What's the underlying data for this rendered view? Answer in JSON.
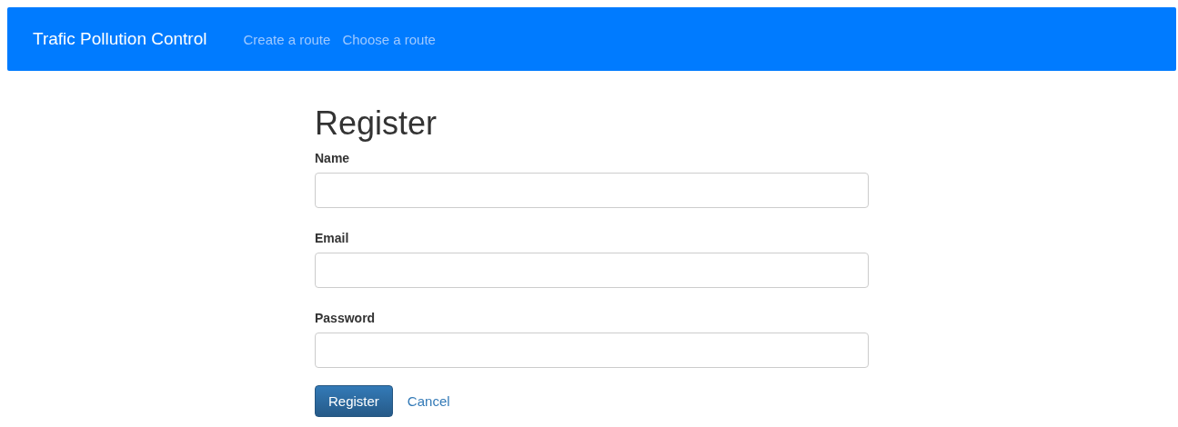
{
  "navbar": {
    "brand": "Trafic Pollution Control",
    "links": [
      {
        "label": "Create a route"
      },
      {
        "label": "Choose a route"
      }
    ]
  },
  "form": {
    "title": "Register",
    "fields": [
      {
        "label": "Name"
      },
      {
        "label": "Email"
      },
      {
        "label": "Password"
      }
    ],
    "submit": "Register",
    "cancel": "Cancel"
  }
}
